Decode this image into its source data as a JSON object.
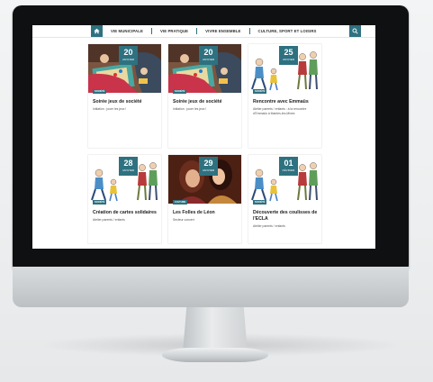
{
  "nav": {
    "items": [
      {
        "label": "VIE MUNICIPALE"
      },
      {
        "label": "VIE PRATIQUE"
      },
      {
        "label": "VIVRE ENSEMBLE"
      },
      {
        "label": "CULTURE, SPORT ET LOISIRS"
      }
    ],
    "home_icon": "home-icon",
    "search_icon": "search-icon"
  },
  "events": [
    {
      "day": "20",
      "month": "JANVIER",
      "tag": "SOCIÉTÉ",
      "title": "Soirée jeux de société",
      "desc": "Initiation : jouer les jeux !",
      "image": "board-game-photo"
    },
    {
      "day": "20",
      "month": "JANVIER",
      "tag": "SOCIÉTÉ",
      "title": "Soirée jeux de société",
      "desc": "Initiation : jouer les jeux !",
      "image": "board-game-photo"
    },
    {
      "day": "25",
      "month": "JANVIER",
      "tag": "SOCIÉTÉ",
      "title": "Rencontre avec Emmaüs",
      "desc": "Atelier parents / enfants : à la rencontre d'Emmaüs à Mantes-les-Mines",
      "image": "family-illustration"
    },
    {
      "day": "28",
      "month": "JANVIER",
      "tag": "SOCIÉTÉ",
      "title": "Création de cartes solidaires",
      "desc": "Atelier parents / enfants",
      "image": "family-illustration"
    },
    {
      "day": "29",
      "month": "JANVIER",
      "tag": "CULTURE",
      "title": "Les Folles de Léon",
      "desc": "Secteur concert",
      "image": "concert-photo"
    },
    {
      "day": "01",
      "month": "FÉVRIER",
      "tag": "SOCIÉTÉ",
      "title": "Découverte des coulisses de l'ECLA",
      "desc": "Atelier parents / enfants",
      "image": "family-illustration"
    }
  ],
  "colors": {
    "accent": "#2e7180",
    "frame": "#0f1012"
  }
}
